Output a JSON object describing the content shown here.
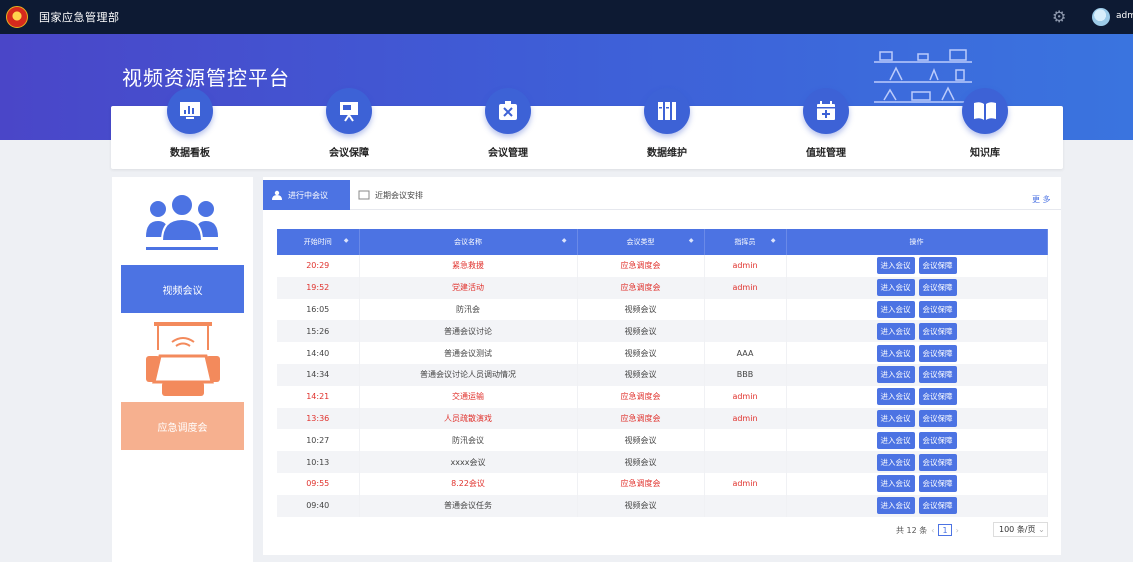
{
  "header": {
    "org_title": "国家应急管理部",
    "user_name": "admin"
  },
  "banner": {
    "title": "视频资源管控平台"
  },
  "nav": [
    {
      "label": "数据看板",
      "icon": "dashboard-icon"
    },
    {
      "label": "会议保障",
      "icon": "presentation-icon"
    },
    {
      "label": "会议管理",
      "icon": "tools-icon"
    },
    {
      "label": "数据维护",
      "icon": "database-icon"
    },
    {
      "label": "值班管理",
      "icon": "calendar-medical-icon"
    },
    {
      "label": "知识库",
      "icon": "book-icon"
    }
  ],
  "sidebar": {
    "video_meeting": "视频会议",
    "dispatch_meeting": "应急调度会"
  },
  "tabs": {
    "active": "进行中会议",
    "inactive": "近期会议安排",
    "more": "更 多"
  },
  "table": {
    "columns": [
      "开始时间",
      "会议名称",
      "会议类型",
      "指挥员",
      "操作"
    ],
    "actions": {
      "enter": "进入会议",
      "guarantee": "会议保障"
    },
    "rows": [
      {
        "time": "20:29",
        "name": "紧急救援",
        "type": "应急调度会",
        "commander": "admin",
        "urgent": true
      },
      {
        "time": "19:52",
        "name": "党建活动",
        "type": "应急调度会",
        "commander": "admin",
        "urgent": true
      },
      {
        "time": "16:05",
        "name": "防汛会",
        "type": "视频会议",
        "commander": "",
        "urgent": false
      },
      {
        "time": "15:26",
        "name": "普通会议讨论",
        "type": "视频会议",
        "commander": "",
        "urgent": false
      },
      {
        "time": "14:40",
        "name": "普通会议测试",
        "type": "视频会议",
        "commander": "AAA",
        "urgent": false
      },
      {
        "time": "14:34",
        "name": "普通会议讨论人员调动情况",
        "type": "视频会议",
        "commander": "BBB",
        "urgent": false
      },
      {
        "time": "14:21",
        "name": "交通运输",
        "type": "应急调度会",
        "commander": "admin",
        "urgent": true
      },
      {
        "time": "13:36",
        "name": "人员疏散演戏",
        "type": "应急调度会",
        "commander": "admin",
        "urgent": true
      },
      {
        "time": "10:27",
        "name": "防汛会议",
        "type": "视频会议",
        "commander": "",
        "urgent": false
      },
      {
        "time": "10:13",
        "name": "xxxx会议",
        "type": "视频会议",
        "commander": "",
        "urgent": false
      },
      {
        "time": "09:55",
        "name": "8.22会议",
        "type": "应急调度会",
        "commander": "admin",
        "urgent": true
      },
      {
        "time": "09:40",
        "name": "普通会议任务",
        "type": "视频会议",
        "commander": "",
        "urgent": false
      }
    ]
  },
  "pagination": {
    "total": "共 12 条",
    "page": "1",
    "page_size": "100 条/页"
  },
  "colors": {
    "primary": "#4c73e3",
    "urgent": "#e0322d",
    "dispatch": "#f6b08f",
    "topbar": "#0d1a33"
  }
}
